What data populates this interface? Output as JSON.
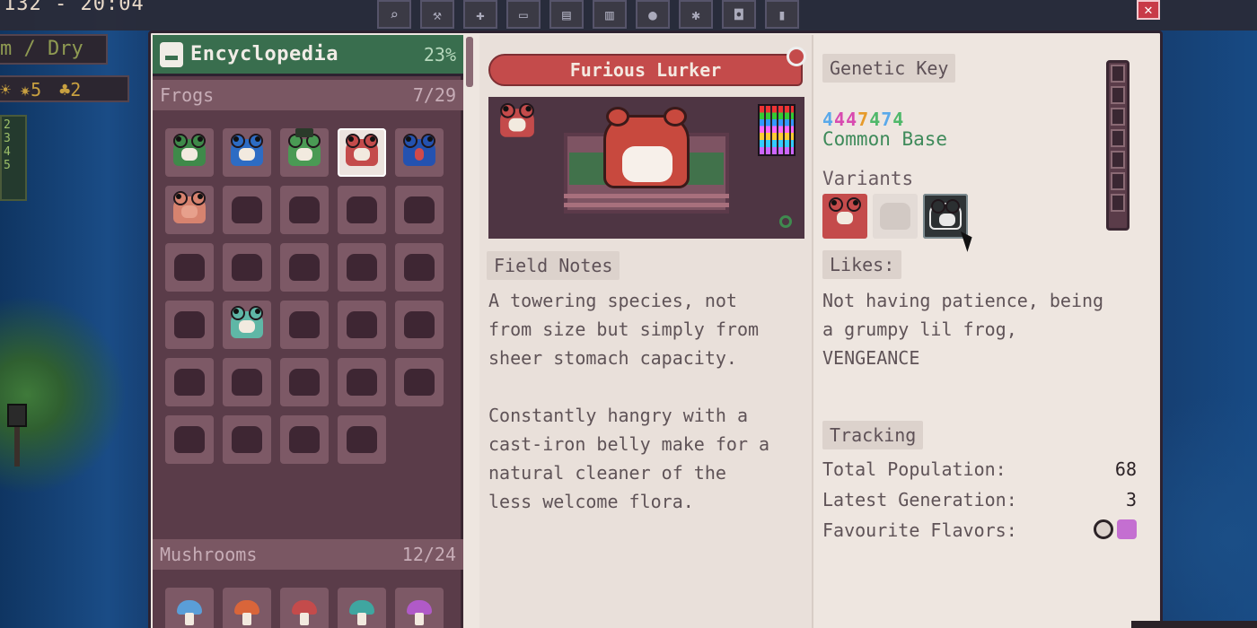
{
  "hud": {
    "top_text": "132 - 20:04",
    "weather": "m / Dry",
    "stat_a": "5",
    "stat_b": "2",
    "side_nums": [
      "2",
      "3",
      "4",
      "5"
    ]
  },
  "window": {
    "close_icon": "close-icon"
  },
  "encyclopedia": {
    "title": "Encyclopedia",
    "percent": "23%",
    "categories": [
      {
        "name": "Frogs",
        "count": "7/29"
      },
      {
        "name": "Mushrooms",
        "count": "12/24"
      }
    ]
  },
  "detail": {
    "name": "Furious Lurker",
    "field_notes_label": "Field Notes",
    "field_notes": "A towering species, not\nfrom size but simply from\nsheer stomach capacity.\n\nConstantly hangry with a\ncast-iron belly make for a\nnatural cleaner of the\nless welcome flora.",
    "genetic_key_label": "Genetic Key",
    "genetic_key_digits": [
      "4",
      "4",
      "4",
      "7",
      "4",
      "7",
      "4"
    ],
    "genetic_key_colors": [
      "#5aa9ea",
      "#d84ab0",
      "#d84ab0",
      "#e69a2a",
      "#4fb86a",
      "#5aa9ea",
      "#4fb86a"
    ],
    "base": "Common Base",
    "variants_label": "Variants",
    "likes_label": "Likes:",
    "likes": "Not having patience, being\na grumpy lil frog,\nVENGEANCE",
    "tracking_label": "Tracking",
    "tracking": [
      {
        "label": "Total Population:",
        "value": "68"
      },
      {
        "label": "Latest Generation:",
        "value": "3"
      },
      {
        "label": "Favourite Flavors:",
        "value": ""
      }
    ]
  },
  "colors": {
    "accent_red": "#c44b4b",
    "panel_green": "#396e4e"
  }
}
